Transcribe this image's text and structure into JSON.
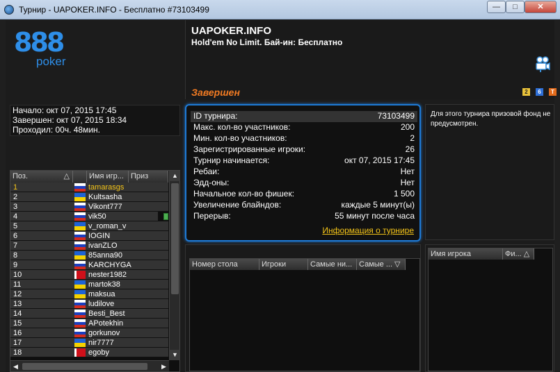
{
  "window": {
    "title": "Турнир - UAPOKER.INFO - Бесплатно #73103499",
    "min_glyph": "—",
    "max_glyph": "□",
    "close_glyph": "✕"
  },
  "logo": {
    "number": "888",
    "word": "poker"
  },
  "header": {
    "site": "UAPOKER.INFO",
    "game": "Hold'em No Limit. Бай-ин: Бесплатно",
    "status": "Завершен",
    "status_color": "#f07a22"
  },
  "time_info": {
    "start": "Начало: окт 07, 2015 17:45",
    "end": "Завершен: окт 07, 2015 18:34",
    "duration": "Проходил: 00ч. 48мин."
  },
  "players": {
    "columns": [
      "Поз.",
      "Имя игр...",
      "Приз"
    ],
    "rows": [
      {
        "pos": "1",
        "flag": "ru",
        "name": "tamarasgs"
      },
      {
        "pos": "2",
        "flag": "ua",
        "name": "Kultsasha"
      },
      {
        "pos": "3",
        "flag": "ru",
        "name": "Vikont777"
      },
      {
        "pos": "4",
        "flag": "ru",
        "name": "vik50"
      },
      {
        "pos": "5",
        "flag": "ua",
        "name": "v_roman_v"
      },
      {
        "pos": "6",
        "flag": "ru",
        "name": "IOGIN"
      },
      {
        "pos": "7",
        "flag": "ru",
        "name": "ivanZLO"
      },
      {
        "pos": "8",
        "flag": "ua",
        "name": "85anna90"
      },
      {
        "pos": "9",
        "flag": "ru",
        "name": "KARCHYGA"
      },
      {
        "pos": "10",
        "flag": "by",
        "name": "nester1982"
      },
      {
        "pos": "11",
        "flag": "ua",
        "name": "martok38"
      },
      {
        "pos": "12",
        "flag": "ua",
        "name": "maksua"
      },
      {
        "pos": "13",
        "flag": "ru",
        "name": "ludilove"
      },
      {
        "pos": "14",
        "flag": "ru",
        "name": "Besti_Best"
      },
      {
        "pos": "15",
        "flag": "ru",
        "name": "APotekhin"
      },
      {
        "pos": "16",
        "flag": "ru",
        "name": "gorkunov"
      },
      {
        "pos": "17",
        "flag": "ua",
        "name": "nir7777"
      },
      {
        "pos": "18",
        "flag": "by",
        "name": "egoby"
      }
    ]
  },
  "tournament": {
    "rows": [
      {
        "label": "ID турнира:",
        "value": "73103499"
      },
      {
        "label": "Макс. кол-во участников:",
        "value": "200"
      },
      {
        "label": "Мин. кол-во участников:",
        "value": "2"
      },
      {
        "label": "Зарегистрированные игроки:",
        "value": "26"
      },
      {
        "label": "Турнир начинается:",
        "value": "окт 07, 2015 17:45"
      },
      {
        "label": "Ребаи:",
        "value": "Нет"
      },
      {
        "label": "Эдд-оны:",
        "value": "Нет"
      },
      {
        "label": "Начальное кол-во фишек:",
        "value": "1 500"
      },
      {
        "label": "Увеличение блайндов:",
        "value": "каждые 5 минут(ы)"
      },
      {
        "label": "Перерыв:",
        "value": "55 минут после часа"
      }
    ],
    "link": "Информация о турнире"
  },
  "prize_note": "Для этого турнира призовой фонд не предусмотрен.",
  "tables_grid": {
    "columns": [
      "Номер стола",
      "Игроки",
      "Самые ни...",
      "Самые ... ▽"
    ]
  },
  "search_grid": {
    "columns": [
      "Имя игрока",
      "Фи... △"
    ]
  },
  "mini_icons": [
    "2",
    "6",
    "T"
  ],
  "colors": {
    "accent": "#1e7ad6",
    "highlight": "#f5c518",
    "brand": "#2e8ee8"
  }
}
